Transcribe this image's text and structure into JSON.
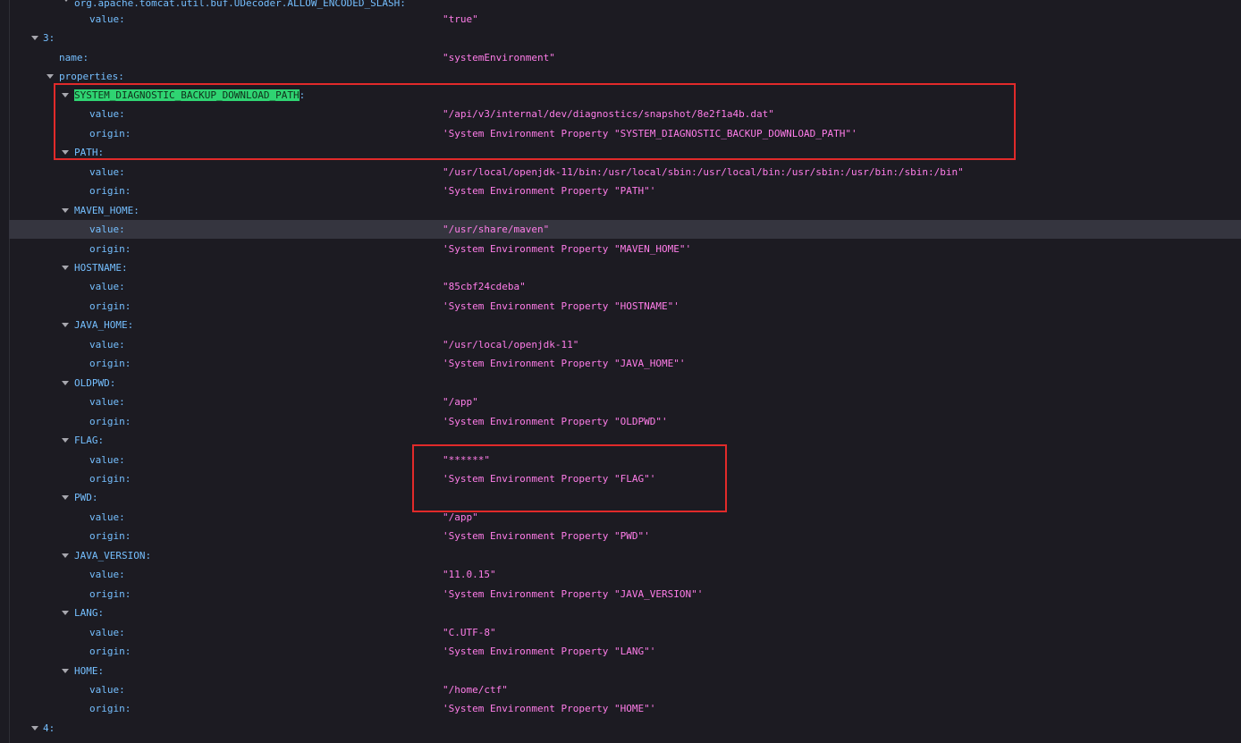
{
  "tree": {
    "top_cut_key": "org.apache.tomcat.util.buf.UDecoder.ALLOW_ENCODED_SLASH:",
    "top_value_key": "value",
    "top_value": "\"true\"",
    "source_3": "3",
    "name_key": "name",
    "name_value": "\"systemEnvironment\"",
    "properties_key": "properties",
    "source_4": "4",
    "entries": [
      {
        "key": "SYSTEM_DIAGNOSTIC_BACKUP_DOWNLOAD_PATH",
        "value": "\"/api/v3/internal/dev/diagnostics/snapshot/8e2f1a4b.dat\"",
        "origin": "'System Environment Property \"SYSTEM_DIAGNOSTIC_BACKUP_DOWNLOAD_PATH\"'"
      },
      {
        "key": "PATH",
        "value": "\"/usr/local/openjdk-11/bin:/usr/local/sbin:/usr/local/bin:/usr/sbin:/usr/bin:/sbin:/bin\"",
        "origin": "'System Environment Property \"PATH\"'"
      },
      {
        "key": "MAVEN_HOME",
        "value": "\"/usr/share/maven\"",
        "origin": "'System Environment Property \"MAVEN_HOME\"'"
      },
      {
        "key": "HOSTNAME",
        "value": "\"85cbf24cdeba\"",
        "origin": "'System Environment Property \"HOSTNAME\"'"
      },
      {
        "key": "JAVA_HOME",
        "value": "\"/usr/local/openjdk-11\"",
        "origin": "'System Environment Property \"JAVA_HOME\"'"
      },
      {
        "key": "OLDPWD",
        "value": "\"/app\"",
        "origin": "'System Environment Property \"OLDPWD\"'"
      },
      {
        "key": "FLAG",
        "value": "\"******\"",
        "origin": "'System Environment Property \"FLAG\"'"
      },
      {
        "key": "PWD",
        "value": "\"/app\"",
        "origin": "'System Environment Property \"PWD\"'"
      },
      {
        "key": "JAVA_VERSION",
        "value": "\"11.0.15\"",
        "origin": "'System Environment Property \"JAVA_VERSION\"'"
      },
      {
        "key": "LANG",
        "value": "\"C.UTF-8\"",
        "origin": "'System Environment Property \"LANG\"'"
      },
      {
        "key": "HOME",
        "value": "\"/home/ctf\"",
        "origin": "'System Environment Property \"HOME\"'"
      }
    ],
    "value_key": "value",
    "origin_key": "origin"
  },
  "colors": {
    "background": "#1c1b22",
    "key": "#75bfff",
    "string": "#ff7de9",
    "highlight": "#2fd472",
    "annotation_box": "#e12a2a"
  }
}
